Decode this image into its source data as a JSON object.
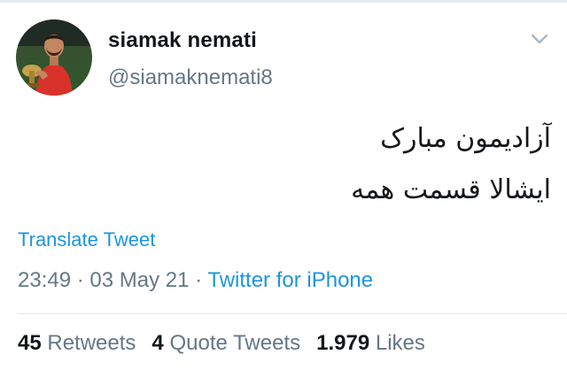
{
  "user": {
    "name": "siamak nemati",
    "handle": "@siamaknemati8"
  },
  "tweet": {
    "lines": [
      "آزادیمون مبارک",
      "ایشالا قسمت همه"
    ]
  },
  "translate_label": "Translate Tweet",
  "meta": {
    "time": "23:49",
    "sep1": " · ",
    "date": "03 May 21",
    "sep2": " · ",
    "source": "Twitter for iPhone"
  },
  "stats": {
    "retweets_count": "45",
    "retweets_label": "Retweets",
    "quotes_count": "4",
    "quotes_label": "Quote Tweets",
    "likes_count": "1.979",
    "likes_label": "Likes"
  },
  "colors": {
    "link": "#1b95e0",
    "secondary": "#657786",
    "primary": "#14171a"
  },
  "icons": {
    "menu": "chevron-down-icon",
    "avatar": "avatar"
  }
}
